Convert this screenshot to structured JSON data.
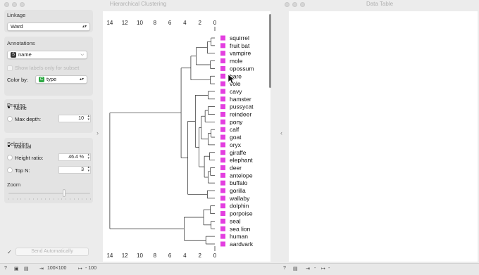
{
  "windows": {
    "left_title": "Hierarchical Clustering",
    "right_title": "Data Table"
  },
  "controls": {
    "linkage": {
      "title": "Linkage",
      "value": "Ward"
    },
    "annotations": {
      "title": "Annotations",
      "value": "name",
      "badge": "S",
      "show_labels": "Show labels only for subset"
    },
    "color_by": {
      "label": "Color by:",
      "value": "type",
      "badge": "C"
    },
    "pruning": {
      "title": "Pruning",
      "none": "None",
      "max_depth_label": "Max depth:",
      "max_depth_value": "10"
    },
    "selection": {
      "title": "Selection",
      "manual": "Manual",
      "height_ratio_label": "Height ratio:",
      "height_ratio_value": "46.4 %",
      "top_n_label": "Top N:",
      "top_n_value": "3"
    },
    "zoom": {
      "title": "Zoom",
      "value_fraction": 0.68
    },
    "send": {
      "label": "Send Automatically"
    }
  },
  "axis": {
    "ticks": [
      "14",
      "12",
      "10",
      "8",
      "6",
      "4",
      "2",
      "0"
    ]
  },
  "leaves": [
    "squirrel",
    "fruit bat",
    "vampire",
    "mole",
    "opossum",
    "hare",
    "vole",
    "cavy",
    "hamster",
    "pussycat",
    "reindeer",
    "pony",
    "calf",
    "goat",
    "oryx",
    "giraffe",
    "elephant",
    "deer",
    "antelope",
    "buffalo",
    "gorilla",
    "wallaby",
    "dolphin",
    "porpoise",
    "seal",
    "sea lion",
    "human",
    "aardvark"
  ],
  "colors": {
    "leaf_marker": "#e33fe0",
    "tree_line": "#222222",
    "accent_blue": "#3a7bd5",
    "badge_green": "#2faa45"
  },
  "statusbar": {
    "size_text": "100×100",
    "output_text": "100"
  }
}
